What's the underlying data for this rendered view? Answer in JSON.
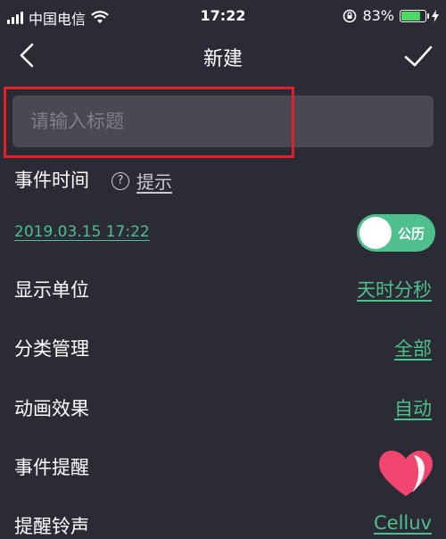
{
  "status_bar": {
    "carrier": "中国电信",
    "time": "17:22",
    "battery": "83%",
    "battery_level": 0.83
  },
  "nav": {
    "title": "新建"
  },
  "title_input": {
    "placeholder": "请输入标题",
    "value": ""
  },
  "event_time": {
    "label": "事件时间",
    "hint_icon": "?",
    "hint": "提示",
    "date": "2019.03.15  17:22",
    "calendar_toggle": "公历"
  },
  "rows": [
    {
      "label": "显示单位",
      "value": "天时分秒"
    },
    {
      "label": "分类管理",
      "value": "全部"
    },
    {
      "label": "动画效果",
      "value": "自动"
    },
    {
      "label": "事件提醒",
      "value": ""
    },
    {
      "label": "提醒铃声",
      "value": "Celluv"
    }
  ],
  "colors": {
    "background": "#2b2b36",
    "accent": "#4fbf8e",
    "input_bg": "#4a4953",
    "highlight": "#e0202a",
    "heart": "#f0456e"
  }
}
